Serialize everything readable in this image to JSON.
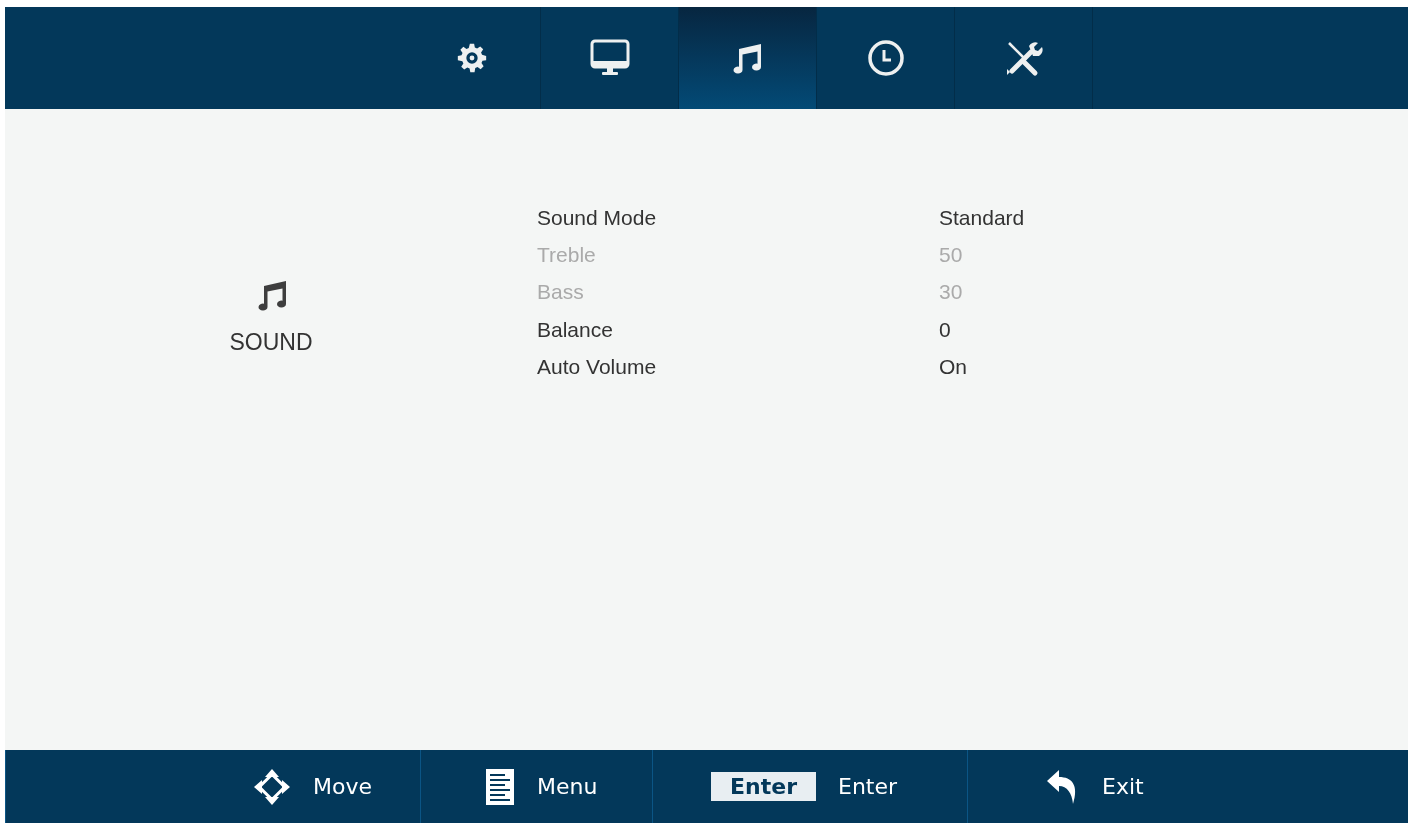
{
  "tabs": [
    {
      "kind": "settings",
      "selected": false
    },
    {
      "kind": "display",
      "selected": false
    },
    {
      "kind": "sound",
      "selected": true
    },
    {
      "kind": "time",
      "selected": false
    },
    {
      "kind": "tools",
      "selected": false
    }
  ],
  "section": {
    "kind": "sound",
    "title": "SOUND"
  },
  "menu_items": [
    {
      "label": "Sound Mode",
      "value": "Standard",
      "disabled": false
    },
    {
      "label": "Treble",
      "value": "50",
      "disabled": true
    },
    {
      "label": "Bass",
      "value": "30",
      "disabled": true
    },
    {
      "label": "Balance",
      "value": "0",
      "disabled": false
    },
    {
      "label": "Auto Volume",
      "value": "On",
      "disabled": false
    }
  ],
  "footer_hints": [
    {
      "kind": "move",
      "label": "Move"
    },
    {
      "kind": "menu",
      "label": "Menu"
    },
    {
      "kind": "key",
      "key": "Enter",
      "label": "Enter"
    },
    {
      "kind": "exit",
      "label": "Exit"
    }
  ]
}
